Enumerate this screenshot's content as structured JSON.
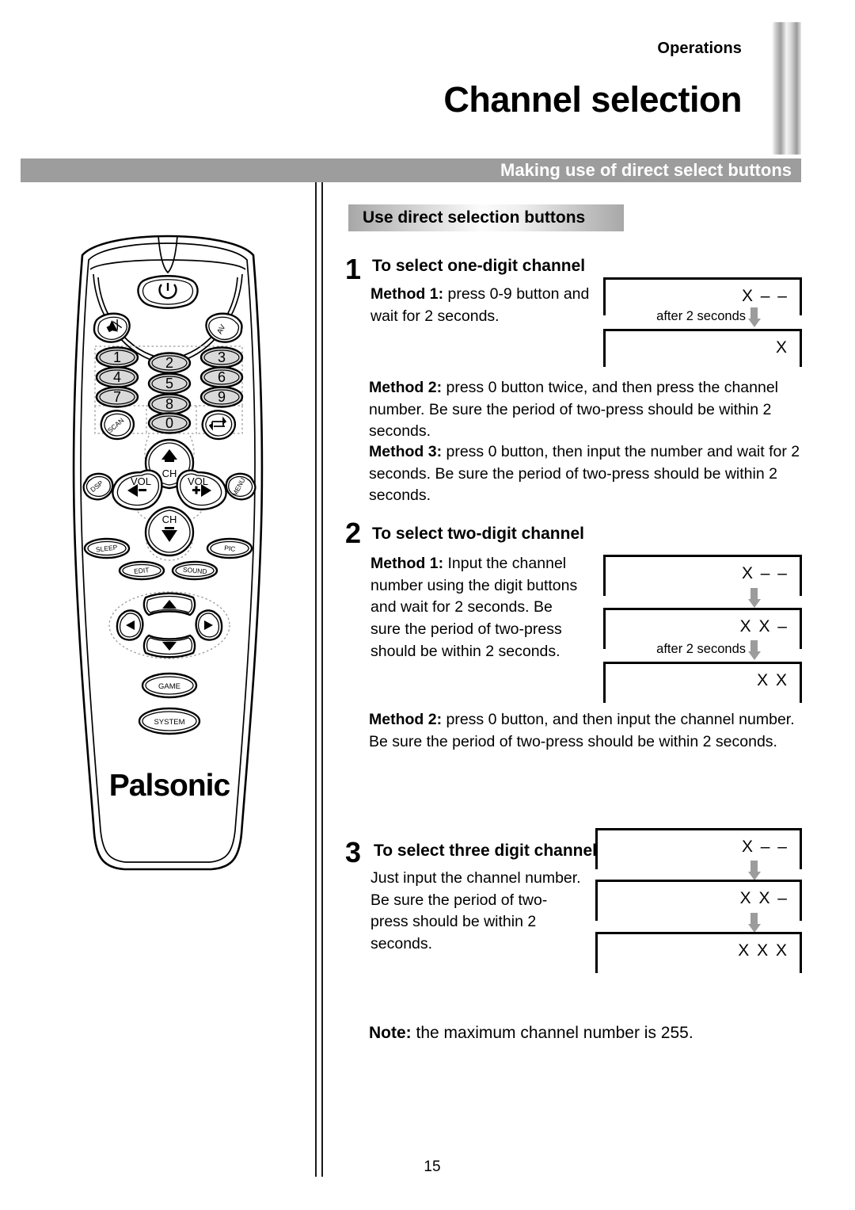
{
  "header": {
    "eyebrow": "Operations",
    "title": "Channel selection",
    "band_label": "Making use of direct select buttons"
  },
  "subhead": "Use direct selection buttons",
  "sections": [
    {
      "number": "1",
      "title": "To select one-digit channel",
      "paragraphs": [
        "Method 1: press 0-9 button and wait for 2 seconds.",
        "Method 2: press 0 button twice, and then press the channel number. Be sure the period of two-press should be within 2 seconds.",
        "Method 3: press 0 button, then input the number and wait for 2 seconds. Be sure the period of two-press should be within 2 seconds."
      ],
      "diagram": {
        "screens": [
          "X – –",
          "X"
        ],
        "arrow_labels": [
          "after 2 seconds"
        ]
      }
    },
    {
      "number": "2",
      "title": "To select two-digit channel",
      "paragraphs": [
        "Method 1: Input the channel number using the digit buttons and wait for 2 seconds. Be sure the period of two-press should be within 2 seconds.",
        "Method 2: press 0 button, and then input the channel number. Be sure the period of two-press should be within 2 seconds."
      ],
      "diagram": {
        "screens": [
          "X – –",
          "X X –",
          "X X"
        ],
        "arrow_labels": [
          "",
          "after 2 seconds"
        ]
      }
    },
    {
      "number": "3",
      "title": "To select three digit channel",
      "paragraphs": [
        "Just input the channel number. Be sure the period of two-press should be within 2 seconds."
      ],
      "diagram": {
        "screens": [
          "X – –",
          "X X –",
          "X X X"
        ],
        "arrow_labels": [
          "",
          ""
        ]
      }
    }
  ],
  "note": {
    "label": "Note:",
    "text": " the maximum channel number is 255."
  },
  "remote": {
    "brand": "Palsonic",
    "buttons": {
      "power": "power-icon",
      "mute": "mute-icon",
      "av": "AV",
      "digits": [
        "1",
        "2",
        "3",
        "4",
        "5",
        "6",
        "7",
        "8",
        "9",
        "0"
      ],
      "scan": "SCAN",
      "recall": "recall-icon",
      "dsp": "DSP",
      "menu": "MENU",
      "vol_down": "VOL",
      "vol_up": "VOL",
      "ch_up": "CH",
      "ch_down": "CH",
      "sleep": "SLEEP",
      "pic": "PIC",
      "edit": "EDIT",
      "sound": "SOUND",
      "game": "GAME",
      "system": "SYSTEM"
    }
  },
  "footer": {
    "page_number": "15"
  },
  "colors": {
    "band_gray": "#9d9d9d",
    "key_fill": "#d9d9d9",
    "arrow_gray": "#9c9c9c"
  }
}
